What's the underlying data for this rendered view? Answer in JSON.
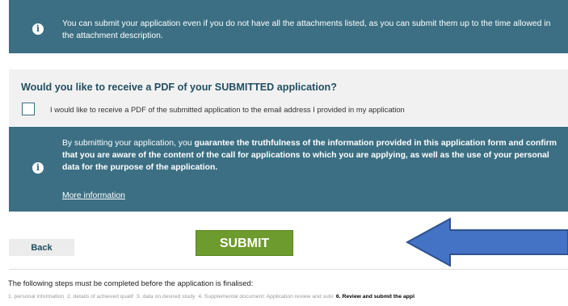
{
  "info_top": {
    "icon": "info-icon",
    "text": "You can submit your application even if you do not have all the attachments listed, as you can submit them up to the time allowed in the attachment description."
  },
  "pdf_section": {
    "title": "Would you like to receive a PDF of your SUBMITTED application?",
    "checkbox_checked": false,
    "checkbox_label": "I would like to receive a PDF of the submitted application to the email address I provided in my application"
  },
  "info_bottom": {
    "icon": "info-icon",
    "text_plain_start": "By submitting your application, you ",
    "text_bold": "guarantee the truthfulness of the information provided in this application form and confirm that you are aware of the content of the call for applications to which you are applying, as well as the use of your personal data for the purpose of the application.",
    "more_link": "More information"
  },
  "actions": {
    "back_label": "Back",
    "submit_label": "SUBMIT"
  },
  "steps": {
    "intro": "The following steps must be completed before the application is finalised:",
    "items": [
      {
        "label": "1. personal information",
        "current": false
      },
      {
        "label": "2. details of achieved qualif",
        "current": false
      },
      {
        "label": "3. data on desired study",
        "current": false
      },
      {
        "label": "4. Supplemental document: Application review and subi",
        "current": false
      },
      {
        "label": "6. Review and submit the appl",
        "current": true
      }
    ]
  },
  "colors": {
    "info_bg": "#3c6f83",
    "submit_bg": "#6d9b2e",
    "arrow_fill": "#4472c4"
  }
}
